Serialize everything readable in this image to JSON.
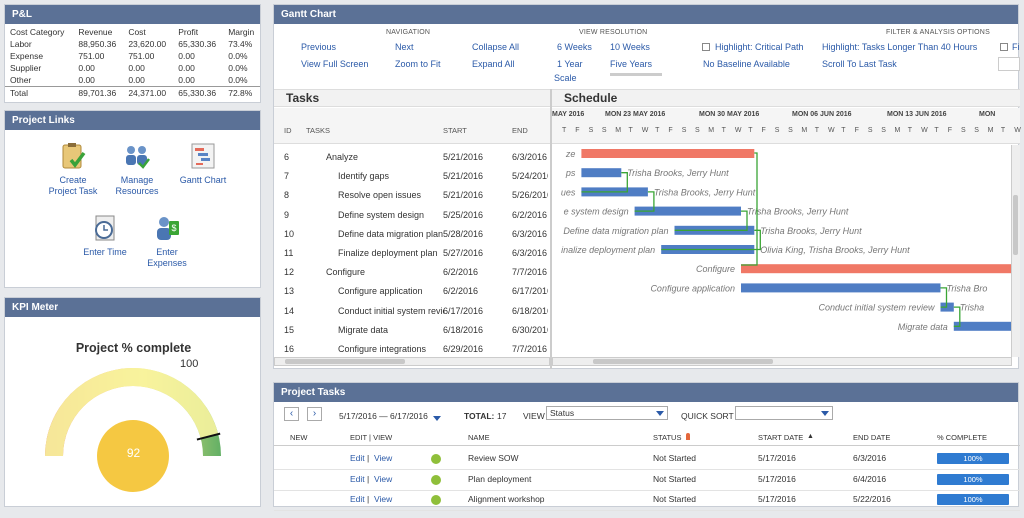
{
  "pnl": {
    "title": "P&L",
    "headers": [
      "Cost Category",
      "Revenue",
      "Cost",
      "Profit",
      "Margin"
    ],
    "rows": [
      [
        "Labor",
        "88,950.36",
        "23,620.00",
        "65,330.36",
        "73.4%"
      ],
      [
        "Expense",
        "751.00",
        "751.00",
        "0.00",
        "0.0%"
      ],
      [
        "Supplier",
        "0.00",
        "0.00",
        "0.00",
        "0.0%"
      ],
      [
        "Other",
        "0.00",
        "0.00",
        "0.00",
        "0.0%"
      ],
      [
        "Total",
        "89,701.36",
        "24,371.00",
        "65,330.36",
        "72.8%"
      ]
    ]
  },
  "links": {
    "title": "Project Links",
    "items": [
      {
        "line1": "Create",
        "line2": "Project Task",
        "icon": "clipboard-check-icon"
      },
      {
        "line1": "Manage",
        "line2": "Resources",
        "icon": "people-icon"
      },
      {
        "line1": "Gantt Chart",
        "line2": "",
        "icon": "gantt-icon"
      },
      {
        "line1": "Enter Time",
        "line2": "",
        "icon": "clock-icon"
      },
      {
        "line1": "Enter",
        "line2": "Expenses",
        "icon": "person-money-icon"
      }
    ]
  },
  "kpi": {
    "title": "KPI Meter",
    "gauge_title": "Project % complete",
    "max_label": "100",
    "value": 92,
    "value_label": "92"
  },
  "gantt": {
    "title": "Gantt Chart",
    "sections": {
      "navigation": "NAVIGATION",
      "view": "VIEW RESOLUTION",
      "filter": "FILTER & ANALYSIS OPTIONS"
    },
    "nav": {
      "previous": "Previous",
      "next": "Next",
      "collapse": "Collapse All",
      "fullscreen": "View Full Screen",
      "zoom": "Zoom to Fit",
      "expand": "Expand All"
    },
    "resolution": {
      "w6": "6 Weeks",
      "w10": "10 Weeks",
      "y1": "1 Year",
      "y5": "Five Years",
      "scale": "Scale"
    },
    "filters": {
      "critical": "Highlight: Critical Path",
      "longer": "Highlight: Tasks Longer Than 40 Hours",
      "nobaseline": "No Baseline Available",
      "scroll": "Scroll To Last Task",
      "fi": "Fi"
    },
    "tasks_title": "Tasks",
    "schedule_title": "Schedule",
    "columns": {
      "id": "ID",
      "tasks": "TASKS",
      "start": "START",
      "end": "END"
    },
    "rows": [
      {
        "id": "6",
        "name": "Analyze",
        "start": "5/21/2016",
        "end": "6/3/2016",
        "indent": 0
      },
      {
        "id": "7",
        "name": "Identify gaps",
        "start": "5/21/2016",
        "end": "5/24/2016",
        "indent": 1
      },
      {
        "id": "8",
        "name": "Resolve open issues",
        "start": "5/21/2016",
        "end": "5/26/2016",
        "indent": 1
      },
      {
        "id": "9",
        "name": "Define system design",
        "start": "5/25/2016",
        "end": "6/2/2016",
        "indent": 1
      },
      {
        "id": "10",
        "name": "Define data migration plan",
        "start": "5/28/2016",
        "end": "6/3/2016",
        "indent": 1
      },
      {
        "id": "11",
        "name": "Finalize deployment plan",
        "start": "5/27/2016",
        "end": "6/3/2016",
        "indent": 1
      },
      {
        "id": "12",
        "name": "Configure",
        "start": "6/2/2016",
        "end": "7/7/2016",
        "indent": 0
      },
      {
        "id": "13",
        "name": "Configure application",
        "start": "6/2/2016",
        "end": "6/17/2016",
        "indent": 1
      },
      {
        "id": "14",
        "name": "Conduct initial system review",
        "start": "6/17/2016",
        "end": "6/18/2016",
        "indent": 1
      },
      {
        "id": "15",
        "name": "Migrate data",
        "start": "6/18/2016",
        "end": "6/30/2016",
        "indent": 1
      },
      {
        "id": "16",
        "name": "Configure integrations",
        "start": "6/29/2016",
        "end": "7/7/2016",
        "indent": 1
      }
    ],
    "weeks": [
      "MAY 2016",
      "MON 23 MAY 2016",
      "MON 30 MAY 2016",
      "MON 06 JUN 2016",
      "MON 13 JUN 2016",
      "MON"
    ],
    "days": [
      "T",
      "F",
      "S",
      "S",
      "M",
      "T",
      "W",
      "T",
      "F",
      "S",
      "S",
      "M",
      "T",
      "W",
      "T",
      "F",
      "S",
      "S",
      "M",
      "T",
      "W",
      "T",
      "F",
      "S",
      "S",
      "M",
      "T",
      "W",
      "T",
      "F",
      "S",
      "S",
      "M",
      "T",
      "W",
      "T",
      "F"
    ],
    "bar_labels": [
      {
        "left": "ze",
        "right": ""
      },
      {
        "left": "ps",
        "right": "Trisha Brooks, Jerry Hunt"
      },
      {
        "left": "ues",
        "right": "Trisha Brooks, Jerry Hunt"
      },
      {
        "left": "e system design",
        "right": "Trisha Brooks, Jerry Hunt"
      },
      {
        "left": "Define data migration plan",
        "right": "Trisha Brooks, Jerry Hunt"
      },
      {
        "left": "inalize deployment plan",
        "right": "Olivia King, Trisha Brooks, Jerry Hunt"
      },
      {
        "left": "Configure",
        "right": ""
      },
      {
        "left": "Configure application",
        "right": "Trisha Bro"
      },
      {
        "left": "Conduct initial system review",
        "right": "Trisha"
      },
      {
        "left": "Migrate data",
        "right": ""
      }
    ],
    "colors": {
      "summary": "#f07866",
      "task": "#4f7dc4",
      "link": "#3aa535"
    }
  },
  "ptasks": {
    "title": "Project Tasks",
    "date_range": "5/17/2016 — 6/17/2016",
    "total_label": "TOTAL:",
    "total": "17",
    "view_label": "VIEW",
    "view_value": "Status",
    "quicksort_label": "QUICK SORT",
    "quicksort_value": "",
    "columns": {
      "new": "NEW",
      "edit": "EDIT | VIEW",
      "name": "NAME",
      "status": "STATUS",
      "start": "START DATE",
      "end": "END DATE",
      "pct": "% COMPLETE"
    },
    "rows": [
      {
        "edit": "Edit",
        "view": "View",
        "name": "Review SOW",
        "status": "Not Started",
        "start": "5/17/2016",
        "end": "6/3/2016",
        "pct": "100%"
      },
      {
        "edit": "Edit",
        "view": "View",
        "name": "Plan deployment",
        "status": "Not Started",
        "start": "5/17/2016",
        "end": "6/4/2016",
        "pct": "100%"
      },
      {
        "edit": "Edit",
        "view": "View",
        "name": "Alignment workshop",
        "status": "Not Started",
        "start": "5/17/2016",
        "end": "5/22/2016",
        "pct": "100%"
      }
    ]
  }
}
